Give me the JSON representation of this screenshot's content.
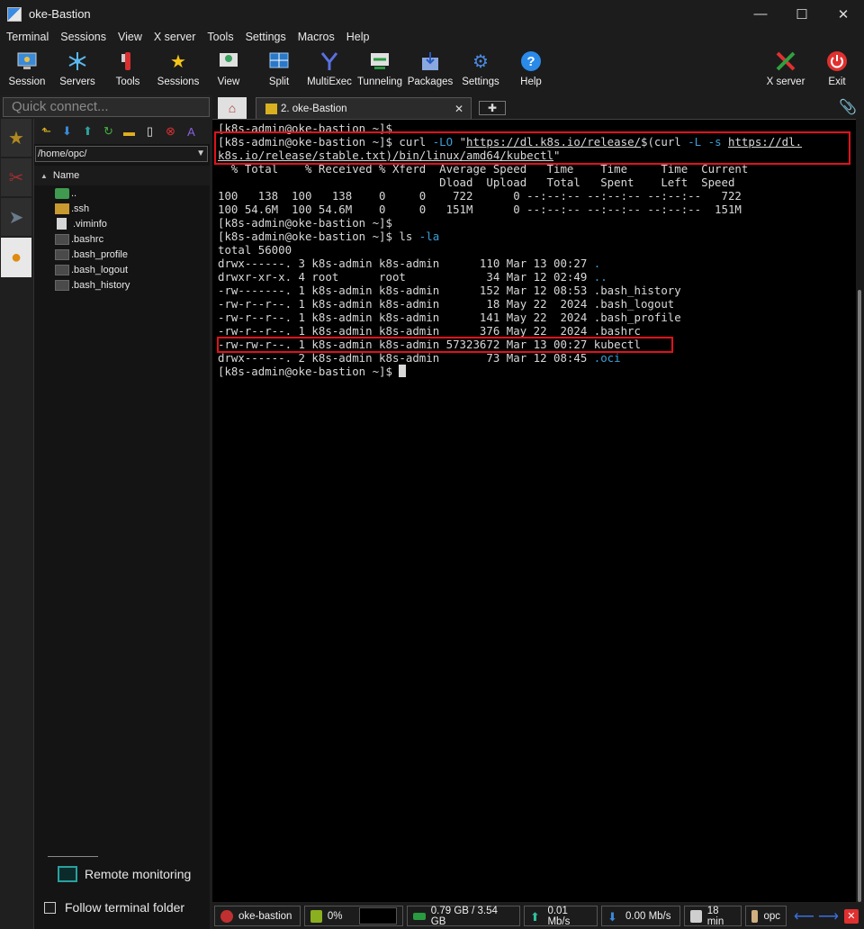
{
  "window": {
    "title": "oke-Bastion",
    "controls": [
      "—",
      "☐",
      "✕"
    ]
  },
  "menu": [
    "Terminal",
    "Sessions",
    "View",
    "X server",
    "Tools",
    "Settings",
    "Macros",
    "Help"
  ],
  "toolbar": [
    {
      "label": "Session",
      "icon": "session-icon"
    },
    {
      "label": "Servers",
      "icon": "servers-icon"
    },
    {
      "label": "Tools",
      "icon": "tools-icon"
    },
    {
      "label": "Sessions",
      "icon": "star-icon"
    },
    {
      "label": "View",
      "icon": "view-icon"
    },
    {
      "label": "Split",
      "icon": "split-icon"
    },
    {
      "label": "MultiExec",
      "icon": "multiexec-icon"
    },
    {
      "label": "Tunneling",
      "icon": "tunneling-icon"
    },
    {
      "label": "Packages",
      "icon": "packages-icon"
    },
    {
      "label": "Settings",
      "icon": "settings-icon"
    },
    {
      "label": "Help",
      "icon": "help-icon"
    },
    {
      "label": "X server",
      "icon": "xserver-icon"
    },
    {
      "label": "Exit",
      "icon": "exit-icon"
    }
  ],
  "quick_connect": {
    "placeholder": "Quick connect..."
  },
  "file_browser": {
    "path": "/home/opc/",
    "column": "Name",
    "files": [
      {
        "name": "..",
        "type": "up"
      },
      {
        "name": ".ssh",
        "type": "folder"
      },
      {
        "name": ".viminfo",
        "type": "doc"
      },
      {
        "name": ".bashrc",
        "type": "dark"
      },
      {
        "name": ".bash_profile",
        "type": "dark"
      },
      {
        "name": ".bash_logout",
        "type": "dark"
      },
      {
        "name": ".bash_history",
        "type": "dark"
      }
    ],
    "remote_monitoring": "Remote monitoring",
    "follow_terminal": "Follow terminal folder"
  },
  "tabs": {
    "session_tab": "2. oke-Bastion",
    "close": "✕",
    "new_tab": "✚"
  },
  "terminal": {
    "lines": [
      "[k8s-admin@oke-bastion ~]$",
      "[k8s-admin@oke-bastion ~]$ curl -LO \"https://dl.k8s.io/release/$(curl -L -s https://dl.",
      "k8s.io/release/stable.txt)/bin/linux/amd64/kubectl\"",
      "  % Total    % Received % Xferd  Average Speed   Time    Time     Time  Current",
      "                                 Dload  Upload   Total   Spent    Left  Speed",
      "100   138  100   138    0     0    722      0 --:--:-- --:--:-- --:--:--   722",
      "100 54.6M  100 54.6M    0     0   151M      0 --:--:-- --:--:-- --:--:--  151M",
      "[k8s-admin@oke-bastion ~]$",
      "[k8s-admin@oke-bastion ~]$ ls -la",
      "total 56000",
      "drwx------. 3 k8s-admin k8s-admin      110 Mar 13 00:27 .",
      "drwxr-xr-x. 4 root      root            34 Mar 12 02:49 ..",
      "-rw-------. 1 k8s-admin k8s-admin      152 Mar 12 08:53 .bash_history",
      "-rw-r--r--. 1 k8s-admin k8s-admin       18 May 22  2024 .bash_logout",
      "-rw-r--r--. 1 k8s-admin k8s-admin      141 May 22  2024 .bash_profile",
      "-rw-r--r--. 1 k8s-admin k8s-admin      376 May 22  2024 .bashrc",
      "-rw-rw-r--. 1 k8s-admin k8s-admin 57323672 Mar 13 00:27 kubectl",
      "drwx------. 2 k8s-admin k8s-admin       73 Mar 12 08:45 .oci",
      "[k8s-admin@oke-bastion ~]$ "
    ]
  },
  "status": {
    "session": "oke-bastion",
    "cpu": "0%",
    "memory": "0.79 GB / 3.54 GB",
    "upload": "0.01 Mb/s",
    "download": "0.00 Mb/s",
    "uptime": "18 min",
    "user": "opc"
  },
  "colors": {
    "highlight": "#e0121b",
    "link_cyan": "#3aa0d8",
    "terminal_bg": "#000000"
  }
}
